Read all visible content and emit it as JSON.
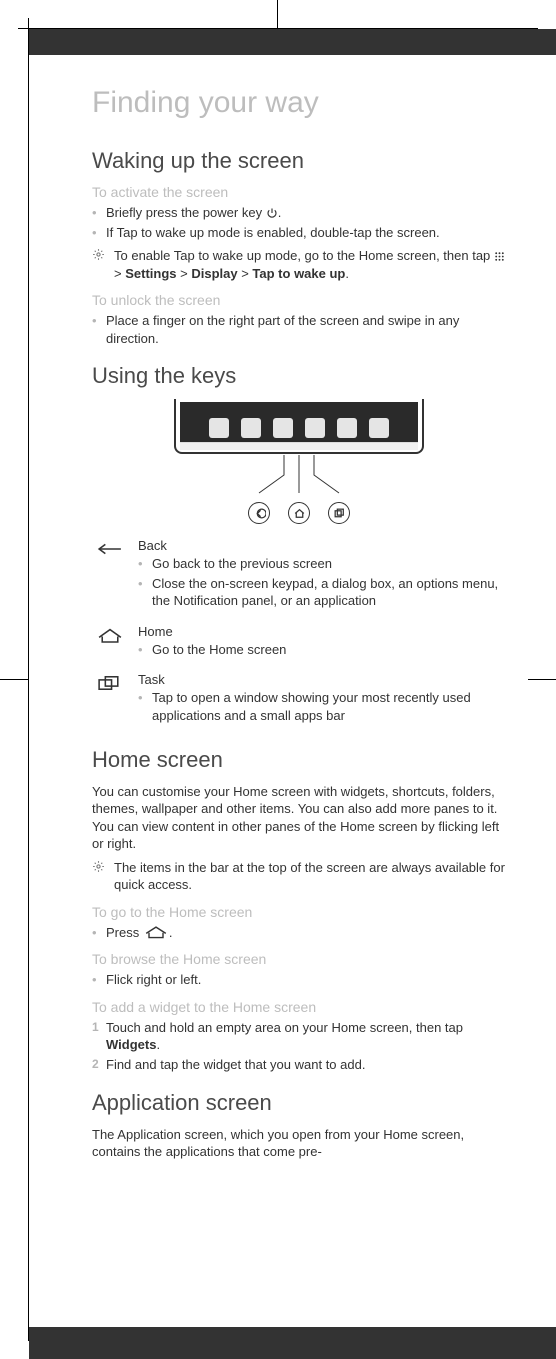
{
  "page_title": "Finding your way",
  "sec_waking": {
    "heading": "Waking up the screen",
    "activate": {
      "sub": "To activate the screen",
      "b1_a": "Briefly press the power key ",
      "b1_b": ".",
      "b2": "If Tap to wake up mode is enabled, double-tap the screen."
    },
    "tip": {
      "a": "To enable Tap to wake up mode, go to the Home screen, then tap ",
      "b": " > ",
      "settings": "Settings",
      "c": " > ",
      "display": "Display",
      "d": " > ",
      "tap_to_wake": "Tap to wake up",
      "e": "."
    },
    "unlock": {
      "sub": "To unlock the screen",
      "b1": "Place a finger on the right part of the screen and swipe in any direction."
    }
  },
  "sec_keys": {
    "heading": "Using the keys",
    "back": {
      "label": "Back",
      "b1": "Go back to the previous screen",
      "b2": "Close the on-screen keypad, a dialog box, an options menu, the Notification panel, or an application"
    },
    "home": {
      "label": "Home",
      "b1": "Go to the Home screen"
    },
    "task": {
      "label": "Task",
      "b1": "Tap to open a window showing your most recently used applications and a small apps bar"
    }
  },
  "sec_home": {
    "heading": "Home screen",
    "intro": "You can customise your Home screen with widgets, shortcuts, folders, themes, wallpaper and other items. You can also add more panes to it. You can view content in other panes of the Home screen by flicking left or right.",
    "tip": "The items in the bar at the top of the screen are always available for quick access.",
    "goto": {
      "sub": "To go to the Home screen",
      "b1_a": "Press ",
      "b1_b": "."
    },
    "browse": {
      "sub": "To browse the Home screen",
      "b1": "Flick right or left."
    },
    "add_widget": {
      "sub": "To add a widget to the Home screen",
      "s1_a": "Touch and hold an empty area on your Home screen, then tap ",
      "s1_b": ".",
      "s1_widgets": "Widgets",
      "s2": "Find and tap the widget that you want to add."
    }
  },
  "sec_app": {
    "heading": "Application screen",
    "intro": "The Application screen, which you open from your Home screen, contains the applications that come pre-"
  },
  "icons": {
    "power": "power-icon",
    "menu_dots": "menu-dots-icon",
    "tip": "tip-icon",
    "back_key": "back-key-icon",
    "home_key": "home-key-icon",
    "task_key": "task-key-icon"
  }
}
